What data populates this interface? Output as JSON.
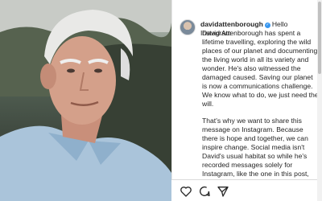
{
  "post": {
    "username": "davidattenborough",
    "greeting": "Hello Instagram",
    "caption_paragraphs": [
      "David Attenborough has spent a lifetime travelling, exploring the wild places of our planet and documenting the living world in all its variety and wonder. He's also witnessed the damaged caused. Saving our planet is now a communications challenge. We know what to do, we just need the will.",
      "That's why we want to share this message on Instagram. Because there is hope and together, we can inspire change. Social media isn't David's usual habitat so while he's recorded messages solely for Instagram, like the one in this post, we're helping to run"
    ]
  },
  "icons": {
    "verified": "verified-badge-icon",
    "like": "heart-icon",
    "comment": "comment-icon",
    "share": "share-icon"
  },
  "colors": {
    "verified": "#3897f0",
    "text": "#262626"
  }
}
